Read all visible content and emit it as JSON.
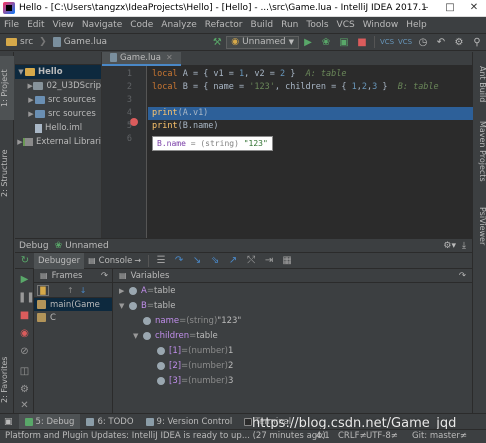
{
  "window": {
    "title": "Hello - [C:\\Users\\tangzx\\IdeaProjects\\Hello] - [Hello] - ...\\src\\Game.lua - IntelliJ IDEA 2017.1",
    "minimize": "–",
    "maximize": "□",
    "close": "✕"
  },
  "menu": [
    "File",
    "Edit",
    "View",
    "Navigate",
    "Code",
    "Analyze",
    "Refactor",
    "Build",
    "Run",
    "Tools",
    "VCS",
    "Window",
    "Help"
  ],
  "toolbar": {
    "breadcrumb_src": "src",
    "breadcrumb_file": "Game.lua",
    "run_config": "Unnamed"
  },
  "left_stripe": {
    "project": "1: Project",
    "structure": "2: Structure",
    "favorites": "2: Favorites"
  },
  "right_stripe": {
    "ant": "Ant Build",
    "maven": "Maven Projects",
    "psi": "PsiViewer"
  },
  "project_tree": [
    {
      "label": "Hello",
      "kind": "root",
      "indent": 0,
      "expanded": true
    },
    {
      "label": "02_U3DScrip",
      "kind": "folder",
      "indent": 1,
      "expanded": false
    },
    {
      "label": "src  sources",
      "kind": "src",
      "indent": 1,
      "expanded": false
    },
    {
      "label": "src  sources",
      "kind": "src",
      "indent": 1,
      "expanded": false
    },
    {
      "label": "Hello.iml",
      "kind": "file",
      "indent": 1,
      "expanded": null
    },
    {
      "label": "External Librari",
      "kind": "lib",
      "indent": 0,
      "expanded": false
    }
  ],
  "editor": {
    "tab": "Game.lua",
    "lines": [
      {
        "num": "1",
        "code": [
          [
            "kw",
            "local "
          ],
          [
            "id",
            "A = { v1 = "
          ],
          [
            "num",
            "1"
          ],
          [
            "id",
            ", v2 = "
          ],
          [
            "num",
            "2"
          ],
          [
            "id",
            " }  "
          ],
          [
            "hint",
            "A: table"
          ]
        ]
      },
      {
        "num": "2",
        "code": [
          [
            "kw",
            "local "
          ],
          [
            "id",
            "B = { name = "
          ],
          [
            "str",
            "'123'"
          ],
          [
            "id",
            ", children = { "
          ],
          [
            "num",
            "1"
          ],
          [
            "id",
            ","
          ],
          [
            "num",
            "2"
          ],
          [
            "id",
            ","
          ],
          [
            "num",
            "3"
          ],
          [
            "id",
            " }  "
          ],
          [
            "hint",
            "B: table"
          ]
        ]
      },
      {
        "num": "3",
        "code": []
      },
      {
        "num": "4",
        "code": [
          [
            "fn",
            "print"
          ],
          [
            "id",
            "(A.v1)"
          ]
        ],
        "highlighted": true,
        "breakpoint": true
      },
      {
        "num": "5",
        "code": [
          [
            "fn",
            "print"
          ],
          [
            "id",
            "(B.name)"
          ]
        ]
      },
      {
        "num": "6",
        "code": []
      }
    ],
    "tooltip": {
      "key": "B.name",
      "eq": " = ",
      "type": "(string) ",
      "value": "\"123\""
    }
  },
  "debug": {
    "title": "Debug",
    "session": "Unnamed",
    "tab_debugger": "Debugger",
    "tab_console": "Console",
    "frames_label": "Frames",
    "variables_label": "Variables",
    "frames": [
      "main(Game",
      "C"
    ],
    "variables": [
      {
        "indent": 0,
        "arrow": "▶",
        "name": "A",
        "eq": " = ",
        "type": "",
        "value": "table"
      },
      {
        "indent": 0,
        "arrow": "▼",
        "name": "B",
        "eq": " = ",
        "type": "",
        "value": "table"
      },
      {
        "indent": 1,
        "arrow": "",
        "name": "name",
        "eq": " = ",
        "type": "(string) ",
        "value": "\"123\""
      },
      {
        "indent": 1,
        "arrow": "▼",
        "name": "children",
        "eq": " = ",
        "type": "",
        "value": "table"
      },
      {
        "indent": 2,
        "arrow": "",
        "name": "[1]",
        "eq": " = ",
        "type": "(number) ",
        "value": "1"
      },
      {
        "indent": 2,
        "arrow": "",
        "name": "[2]",
        "eq": " = ",
        "type": "(number) ",
        "value": "2"
      },
      {
        "indent": 2,
        "arrow": "",
        "name": "[3]",
        "eq": " = ",
        "type": "(number) ",
        "value": "3"
      }
    ]
  },
  "tool_tabs": {
    "debug": "5: Debug",
    "todo": "6: TODO",
    "vcs": "9: Version Control",
    "terminal": "Terminal"
  },
  "watermark": "https://blog.csdn.net/Game_jqd",
  "status": {
    "message": "Platform and Plugin Updates: IntelliJ IDEA is ready to up... (27 minutes ago)",
    "position": "4:1",
    "line_sep": "CRLF≠",
    "encoding": "UTF-8≠",
    "git": "Git: master≠"
  },
  "colors": {
    "background": "#3c3f41",
    "editor_bg": "#2b2b2b",
    "keyword": "#cc7832",
    "function": "#ffc66d",
    "number": "#6897bb",
    "string": "#6a8759",
    "highlight": "#2d6099",
    "breakpoint": "#db5c5c",
    "run_green": "#59a869"
  }
}
